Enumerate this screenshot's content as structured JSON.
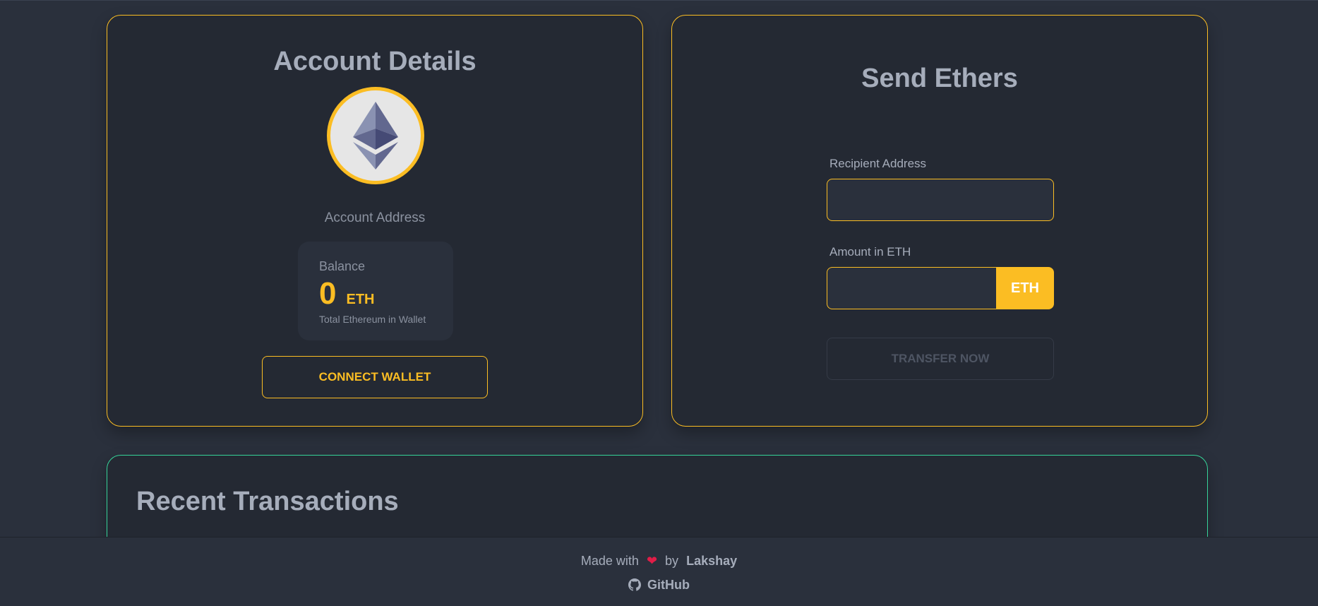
{
  "account": {
    "title": "Account Details",
    "logo_icon": "ethereum-icon",
    "address_label": "Account Address",
    "balance": {
      "title": "Balance",
      "value": "0",
      "unit": "ETH",
      "description": "Total Ethereum in Wallet"
    },
    "connect_button": "CONNECT WALLET"
  },
  "send": {
    "title": "Send Ethers",
    "recipient_label": "Recipient Address",
    "recipient_value": "",
    "amount_label": "Amount in ETH",
    "amount_value": "",
    "amount_unit": "ETH",
    "transfer_button": "TRANSFER NOW"
  },
  "transactions": {
    "title": "Recent Transactions"
  },
  "footer": {
    "made_with": "Made with",
    "heart_icon": "heart-icon",
    "by": "by",
    "author": "Lakshay",
    "github_icon": "github-icon",
    "github_label": "GitHub"
  },
  "colors": {
    "background": "#2a303c",
    "card": "#242933",
    "accent": "#fbbd23",
    "success": "#36d399",
    "text": "#a6adbb"
  }
}
